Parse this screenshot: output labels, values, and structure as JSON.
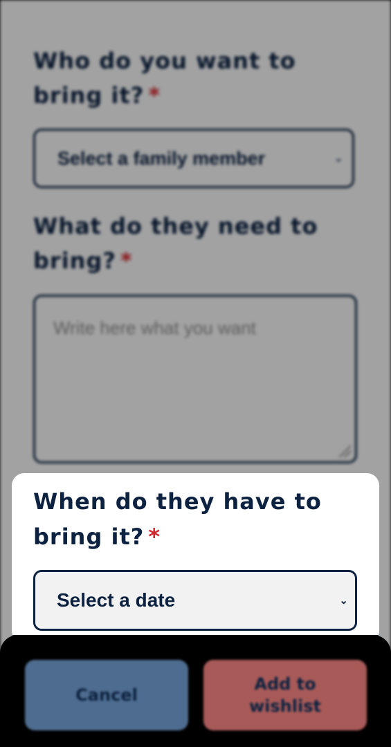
{
  "form": {
    "who_question": "Who do you want to bring it?",
    "who_required": "*",
    "member_select_value": "Select a family member",
    "what_question": "What do they need to bring?",
    "what_required": "*",
    "what_placeholder": "Write here what you want",
    "when_question": "When do they have to bring it?",
    "when_required": "*",
    "date_select_value": "Select a date"
  },
  "actions": {
    "cancel_label": "Cancel",
    "add_label": "Add to wishlist"
  },
  "icons": {
    "select_chevron": "chevron-down-icon"
  },
  "colors": {
    "navy": "#0d2240",
    "required": "#d0282e",
    "cancel_bg": "#4e6c8f",
    "add_bg": "#a85a58"
  }
}
